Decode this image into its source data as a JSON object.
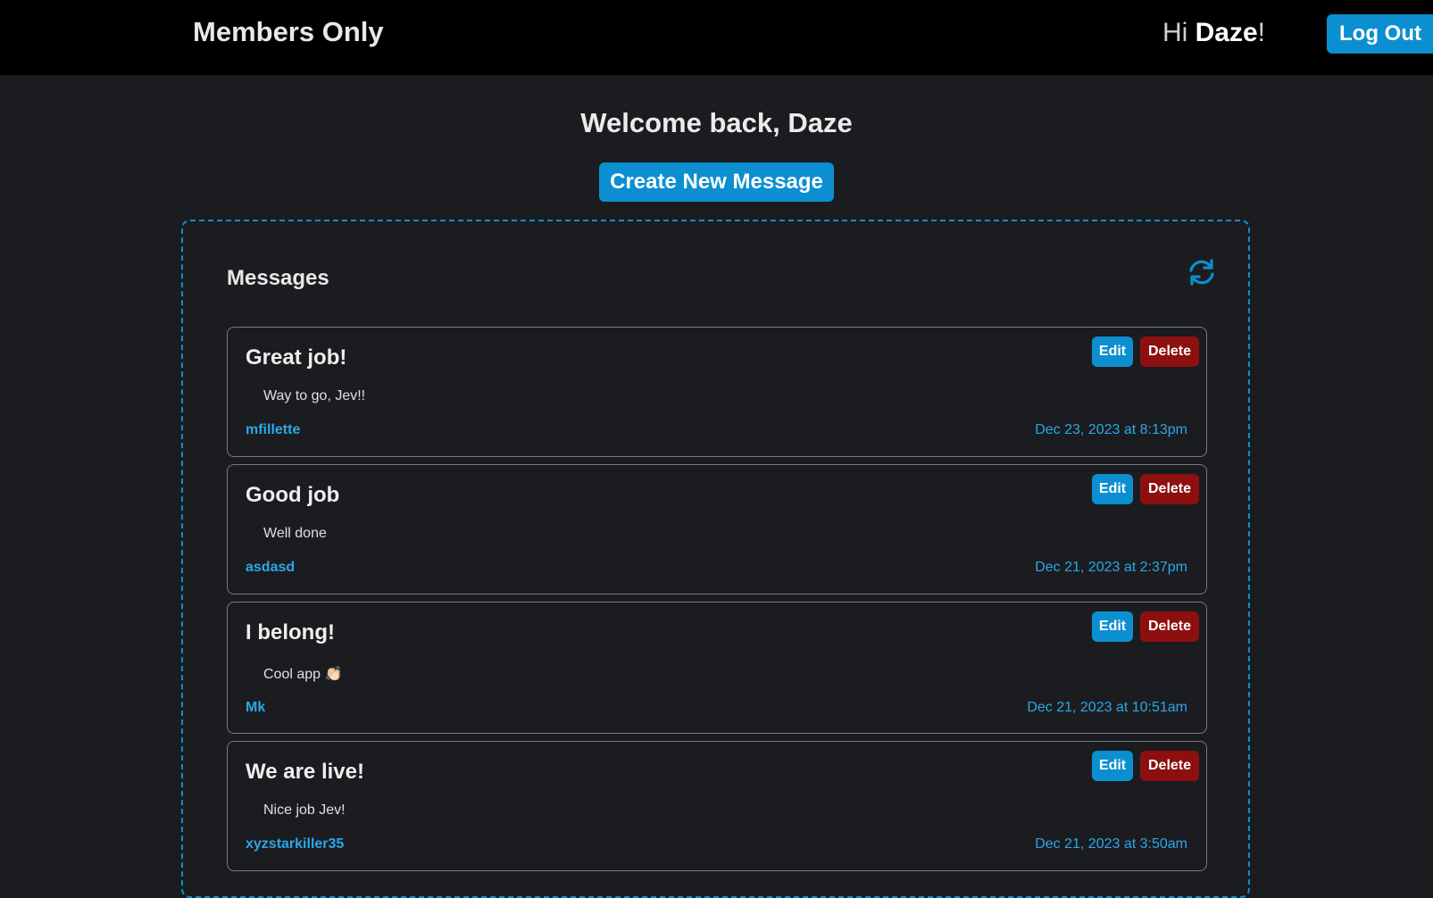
{
  "header": {
    "brand": "Members Only",
    "greeting_prefix": "Hi ",
    "username": "Daze",
    "greeting_suffix": "!",
    "logout_label": "Log Out"
  },
  "main": {
    "welcome": "Welcome back, Daze",
    "create_label": "Create New Message",
    "messages_title": "Messages",
    "edit_label": "Edit",
    "delete_label": "Delete"
  },
  "messages": [
    {
      "title": "Great job!",
      "body": "Way to go, Jev!!",
      "author": "mfillette",
      "date": "Dec 23, 2023 at 8:13pm"
    },
    {
      "title": "Good job",
      "body": "Well done",
      "author": "asdasd",
      "date": "Dec 21, 2023 at 2:37pm"
    },
    {
      "title": "I belong!",
      "body": "Cool app 👏🏻",
      "author": "Mk",
      "date": "Dec 21, 2023 at 10:51am"
    },
    {
      "title": "We are live!",
      "body": "Nice job Jev!",
      "author": "xyzstarkiller35",
      "date": "Dec 21, 2023 at 3:50am"
    }
  ],
  "colors": {
    "accent": "#0b8fd0",
    "danger": "#8e0f0f",
    "link": "#2ba7e8",
    "header_bg": "#000000",
    "page_bg": "#1b1c1f"
  },
  "icons": {
    "refresh": "refresh-icon"
  }
}
